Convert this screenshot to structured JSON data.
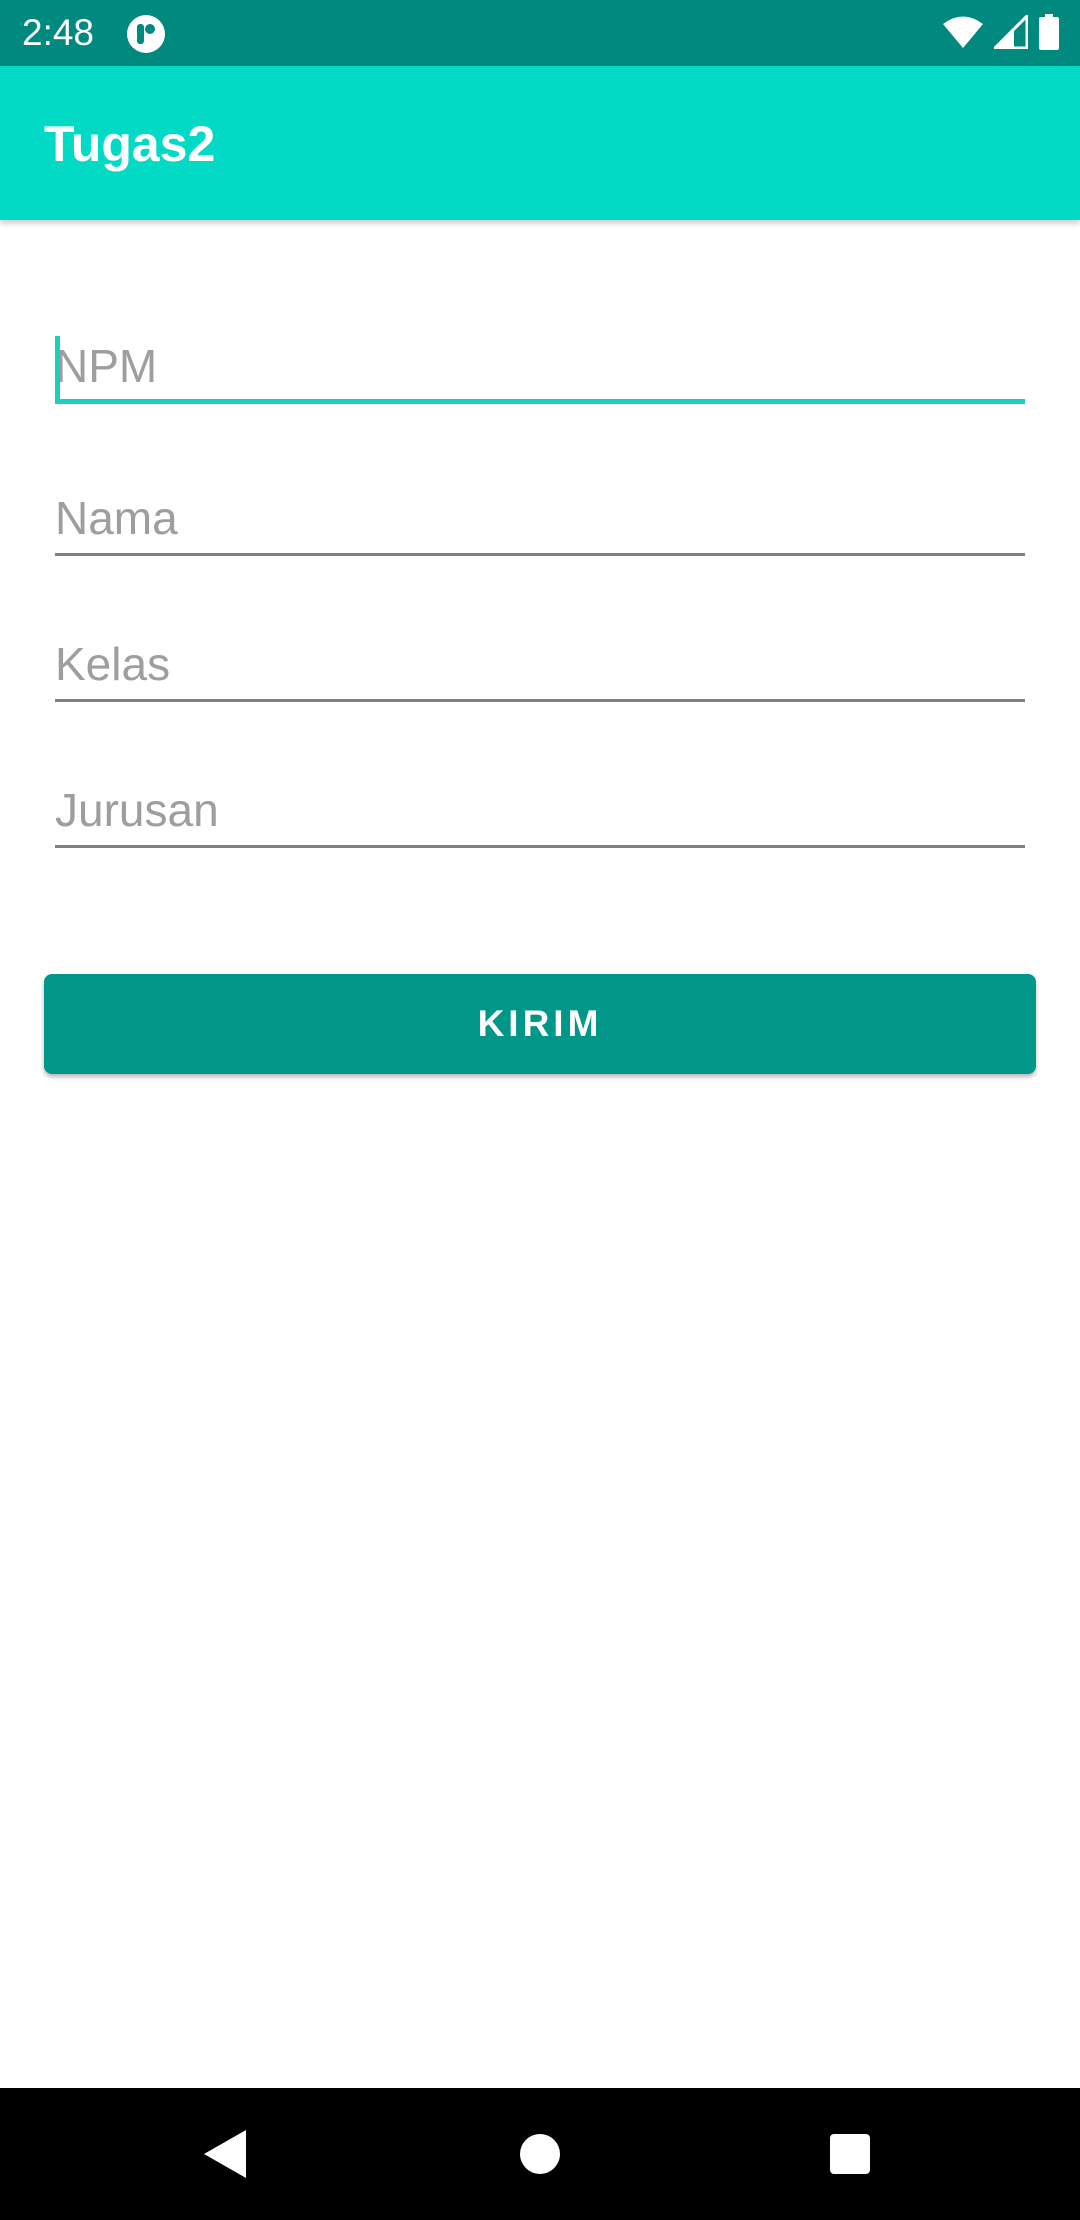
{
  "status_bar": {
    "time": "2:48",
    "background_color": "#00897f",
    "icons": [
      "app-notification-icon",
      "wifi-icon",
      "signal-icon",
      "battery-icon"
    ]
  },
  "app_bar": {
    "title": "Tugas2",
    "background_color": "#03dac5"
  },
  "form": {
    "fields": [
      {
        "name": "npm",
        "value": "",
        "placeholder": "NPM",
        "focused": true
      },
      {
        "name": "nama",
        "value": "",
        "placeholder": "Nama",
        "focused": false
      },
      {
        "name": "kelas",
        "value": "",
        "placeholder": "Kelas",
        "focused": false
      },
      {
        "name": "jurusan",
        "value": "",
        "placeholder": "Jurusan",
        "focused": false
      }
    ],
    "submit_label": "KIRIM",
    "submit_color": "#009688",
    "accent_color": "#1bcfbf"
  },
  "nav_bar": {
    "buttons": [
      "back-icon",
      "home-icon",
      "recents-icon"
    ]
  }
}
